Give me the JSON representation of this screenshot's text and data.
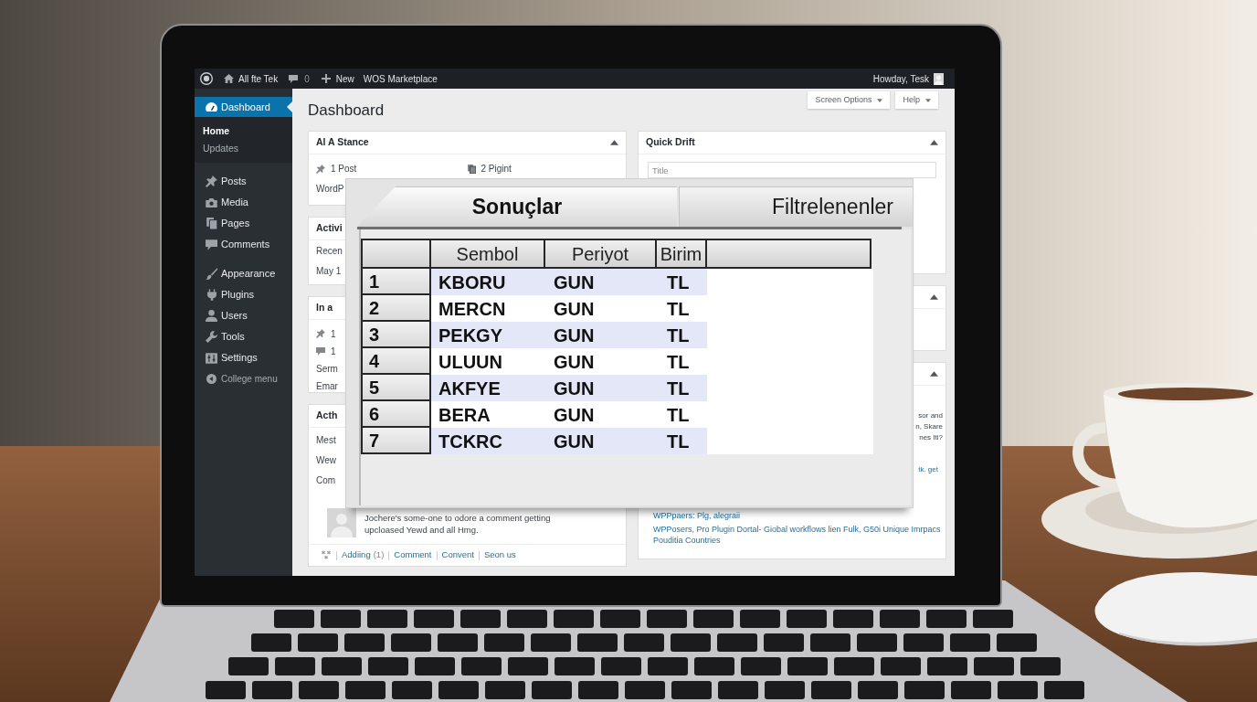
{
  "admin_bar": {
    "site_name": "All fte Tek",
    "comments_count": "0",
    "new_label": "New",
    "marketplace_label": "WOS Marketplace",
    "greeting": "Howday, Tesk"
  },
  "sidebar": {
    "groups": [
      {
        "items": [
          {
            "label": "Dashboard",
            "kind": "menu",
            "selected": true,
            "children": [
              {
                "label": "Home",
                "selected": true
              },
              {
                "label": "Updates",
                "selected": false
              }
            ]
          }
        ]
      },
      {
        "items": [
          {
            "label": "Posts",
            "kind": "menu",
            "selected": false
          },
          {
            "label": "Media",
            "kind": "menu",
            "selected": false
          },
          {
            "label": "Pages",
            "kind": "menu",
            "selected": false
          },
          {
            "label": "Comments",
            "kind": "menu",
            "selected": false
          }
        ]
      },
      {
        "items": [
          {
            "label": "Appearance",
            "kind": "menu",
            "selected": false
          },
          {
            "label": "Plugins",
            "kind": "menu",
            "selected": false
          },
          {
            "label": "Users",
            "kind": "menu",
            "selected": false
          },
          {
            "label": "Tools",
            "kind": "menu",
            "selected": false
          },
          {
            "label": "Settings",
            "kind": "menu",
            "selected": false
          },
          {
            "label": "College menu",
            "kind": "collapse",
            "selected": false
          }
        ]
      }
    ]
  },
  "page_title": "Dashboard",
  "header_buttons": [
    "Screen Options",
    "Help"
  ],
  "left_widgets": [
    {
      "title": "Al A Stance",
      "toggle": true,
      "rows": [
        [
          {
            "kind": "post_count",
            "text": "1 Post"
          },
          {
            "kind": "page_count",
            "text": "2 Pigint"
          }
        ],
        [
          {
            "kind": "text",
            "text": "WordP"
          }
        ]
      ]
    },
    {
      "title": "Activi",
      "rows": [
        [
          {
            "kind": "text",
            "text": "Recen"
          }
        ],
        [
          {
            "kind": "text",
            "text": "May 1"
          }
        ]
      ]
    },
    {
      "title": "In a",
      "rows": [
        [
          {
            "kind": "post_count",
            "text": "1"
          }
        ],
        [
          {
            "kind": "comment_count",
            "text": "1"
          }
        ],
        [
          {
            "kind": "text",
            "text": "Serm"
          }
        ],
        [
          {
            "kind": "text",
            "text": "Emar"
          }
        ]
      ]
    },
    {
      "title": "Acth",
      "rows": [
        [
          {
            "kind": "text",
            "text": "Mest"
          }
        ],
        [
          {
            "kind": "text",
            "text": "Wew"
          }
        ],
        [
          {
            "kind": "text",
            "text": "Com"
          }
        ]
      ],
      "comment": {
        "lines": [
          "Jochere's some-one to odore a comment getting",
          "upcloased Yewd and all Hmg."
        ]
      },
      "footer_links": [
        {
          "label": "Addiing",
          "count": "(1)"
        },
        {
          "label": "Comment"
        },
        {
          "label": "Convent"
        },
        {
          "label": "Seon us"
        }
      ]
    }
  ],
  "right_widgets": [
    {
      "title": "Quick Drift",
      "toggle": true,
      "title_field": {
        "placeholder": "Title"
      }
    },
    {
      "toggle": true
    },
    {
      "toggle": true,
      "excerpt_lines": [
        "sor and",
        "n, Skare",
        "nes Iti?"
      ],
      "links": [
        "tk. get"
      ],
      "news": [
        "WPPpaers: Plg, alegraii",
        "WPPosers, Pro Plugin Dortal- Giobal workflows lien Fulk, G50i Unique Imrpacs Pouditia Countries"
      ]
    }
  ],
  "results_window": {
    "tabs": [
      {
        "label": "Sonuçlar",
        "selected": true
      },
      {
        "label": "Filtrelenenler",
        "selected": false
      }
    ],
    "columns": [
      "Sembol",
      "Periyot",
      "Birim"
    ],
    "rows": [
      {
        "number": "1",
        "cells": [
          "KBORU",
          "GUN",
          "TL"
        ]
      },
      {
        "number": "2",
        "cells": [
          "MERCN",
          "GUN",
          "TL"
        ]
      },
      {
        "number": "3",
        "cells": [
          "PEKGY",
          "GUN",
          "TL"
        ]
      },
      {
        "number": "4",
        "cells": [
          "ULUUN",
          "GUN",
          "TL"
        ]
      },
      {
        "number": "5",
        "cells": [
          "AKFYE",
          "GUN",
          "TL"
        ]
      },
      {
        "number": "6",
        "cells": [
          "BERA",
          "GUN",
          "TL"
        ]
      },
      {
        "number": "7",
        "cells": [
          "TCKRC",
          "GUN",
          "TL"
        ]
      }
    ]
  }
}
